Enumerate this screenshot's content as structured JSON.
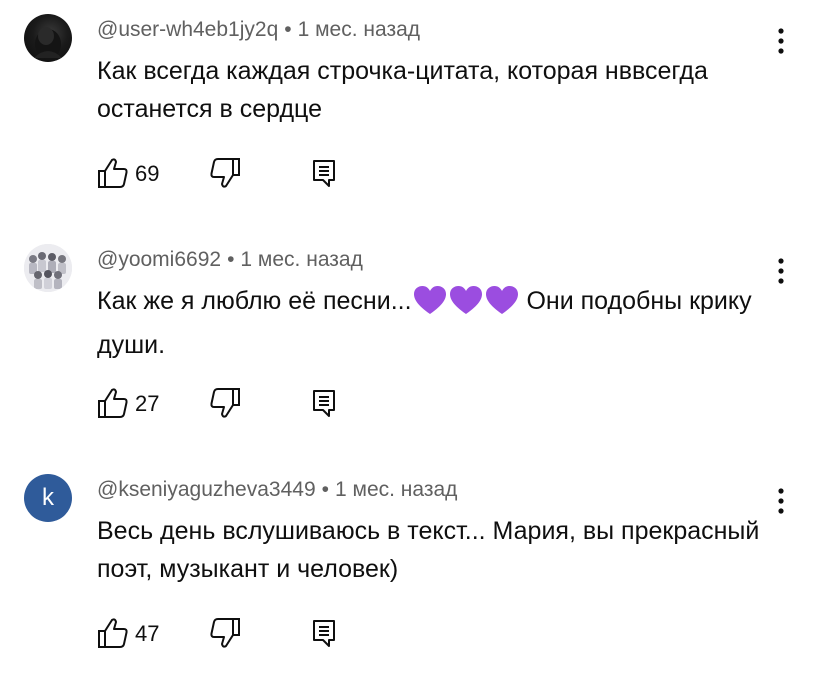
{
  "colors": {
    "text": "#0f0f0f",
    "meta": "#606060",
    "heart": "#9b4de0",
    "avatar_letter_bg": "#2f5b9a"
  },
  "comments": [
    {
      "author": "@user-wh4eb1jy2q",
      "time": "1 мес. назад",
      "avatar": "dark-photo",
      "text": "Как всегда каждая строчка-цитата, которая нввсегда останется в сердце",
      "likes": "69"
    },
    {
      "author": "@yoomi6692",
      "time": "1 мес. назад",
      "avatar": "group-photo",
      "text_before": "Как же я люблю её песни...",
      "emoji": "purple-heart-icon x3",
      "text_after": " Они подобны крику души.",
      "likes": "27"
    },
    {
      "author": "@kseniyaguzheva3449",
      "time": "1 мес. назад",
      "avatar_letter": "k",
      "text": "Весь день вслушиваюсь в текст... Мария, вы прекрасный поэт, музыкант и человек)",
      "likes": "47"
    }
  ],
  "icons": {
    "like": "thumbs-up-icon",
    "dislike": "thumbs-down-icon",
    "reply": "reply-icon",
    "menu": "more-vert-icon"
  }
}
